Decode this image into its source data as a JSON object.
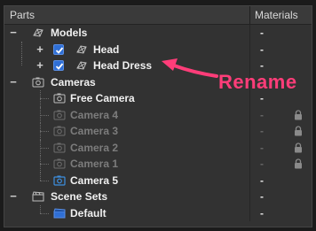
{
  "header": {
    "parts_label": "Parts",
    "materials_label": "Materials"
  },
  "rows": [
    {
      "label": "Models",
      "material": "-"
    },
    {
      "label": "Head",
      "material": "-"
    },
    {
      "label": "Head Dress",
      "material": "-"
    },
    {
      "label": "Cameras",
      "material": "-"
    },
    {
      "label": "Free Camera",
      "material": "-"
    },
    {
      "label": "Camera 4",
      "material": "-"
    },
    {
      "label": "Camera 3",
      "material": "-"
    },
    {
      "label": "Camera 2",
      "material": "-"
    },
    {
      "label": "Camera 1",
      "material": "-"
    },
    {
      "label": "Camera 5",
      "material": "-"
    },
    {
      "label": "Scene Sets",
      "material": "-"
    },
    {
      "label": "Default",
      "material": "-"
    }
  ],
  "annotation": {
    "text": "Rename"
  },
  "expanders": {
    "minus": "−",
    "plus": "+"
  },
  "colors": {
    "accent": "#ff3d79",
    "checkbox": "#2f6fd6",
    "camera_active": "#3d8fe0"
  },
  "icons": [
    "mesh-icon",
    "camera-icon",
    "scene-set-icon",
    "lock-icon"
  ]
}
